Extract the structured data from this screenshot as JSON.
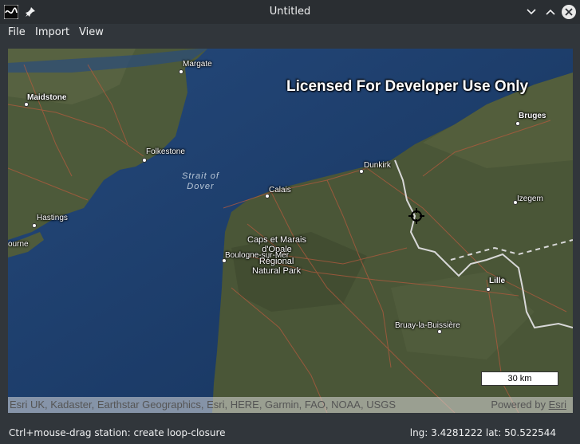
{
  "window": {
    "title": "Untitled",
    "app_icon": "app-logo-icon",
    "pin_icon": "pin-icon",
    "buttons": [
      "minimize",
      "maximize",
      "close"
    ]
  },
  "menu": {
    "file": "File",
    "import": "Import",
    "view": "View"
  },
  "map": {
    "watermark": "Licensed For Developer Use Only",
    "sea_label_line1": "Strait of",
    "sea_label_line2": "Dover",
    "places": {
      "margate": "Margate",
      "maidstone": "Maidstone",
      "folkestone": "Folkestone",
      "bruges": "Bruges",
      "dunkirk": "Dunkirk",
      "calais": "Calais",
      "izegem": "Izegem",
      "hastings": "Hastings",
      "eastbourne": "ourne",
      "caps_line1": "Caps et Marais",
      "caps_line2": "d'Opale",
      "boulogne": "Boulogne-sur-Mer",
      "regional_line1": "Régional",
      "regional_line2": "Natural Park",
      "lille": "Lille",
      "bruay": "Bruay-la-Buissière"
    },
    "scale": "30 km",
    "attribution": "Esri UK, Kadaster, Earthstar Geographics, Esri, HERE, Garmin, FAO, NOAA, USGS",
    "powered_by": "Powered by",
    "powered_link": "Esri",
    "marker": "crosshair-target-icon"
  },
  "status": {
    "hint": "Ctrl+mouse-drag station: create loop-closure",
    "coords": "lng: 3.4281222 lat: 50.522544"
  }
}
